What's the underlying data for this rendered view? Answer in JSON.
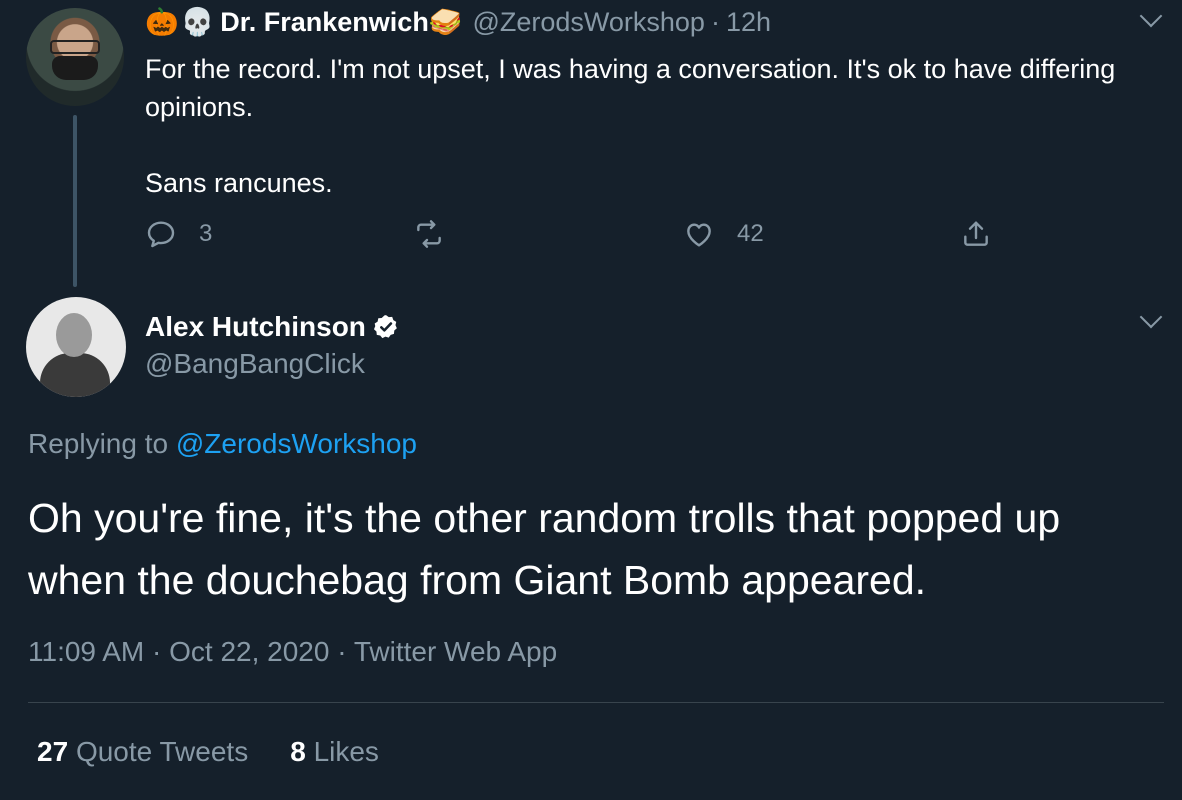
{
  "parent_tweet": {
    "emojis": [
      "🎃",
      "💀"
    ],
    "name_emoji": "🥪",
    "display_name": "Dr. Frankenwich",
    "handle": "@ZerodsWorkshop",
    "separator": "·",
    "time_ago": "12h",
    "text": "For the record. I'm not upset, I was having a conversation. It's ok to have differing opinions.\n\nSans rancunes.",
    "replies": "3",
    "retweets": "",
    "likes": "42"
  },
  "main_tweet": {
    "display_name": "Alex Hutchinson",
    "handle": "@BangBangClick",
    "replying_prefix": "Replying to",
    "replying_handle": "@ZerodsWorkshop",
    "text": "Oh you're fine, it's the other random trolls that popped up when the douchebag from Giant Bomb appeared.",
    "timestamp": "11:09 AM · Oct 22, 2020 · Twitter Web App",
    "quote_tweets_count": "27",
    "quote_tweets_label": "Quote Tweets",
    "likes_count": "8",
    "likes_label": "Likes"
  },
  "colors": {
    "background": "#15202b",
    "text_primary": "#ffffff",
    "text_secondary": "#8899a6",
    "link": "#1da1f2",
    "divider": "#38444d"
  },
  "icons": [
    "reply-icon",
    "retweet-icon",
    "like-icon",
    "share-icon",
    "verified-icon",
    "chevron-down-icon"
  ]
}
